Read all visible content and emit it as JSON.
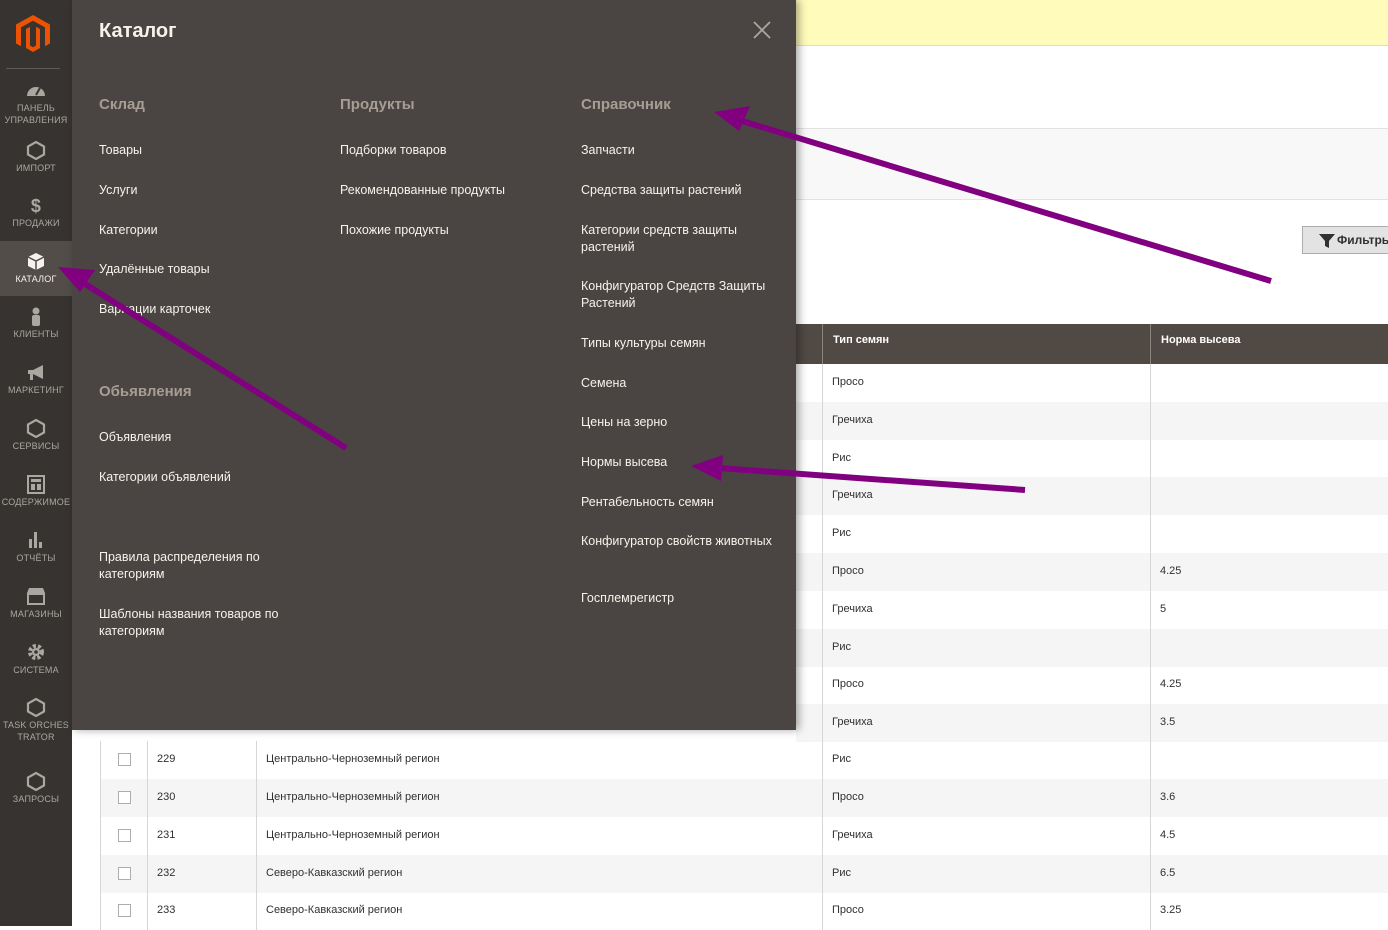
{
  "sidebar": {
    "items": [
      {
        "label": "ПАНЕЛЬ УПРАВЛЕНИЯ",
        "icon": "dashboard-icon"
      },
      {
        "label": "ИМПОРТ",
        "icon": "hexagon-icon"
      },
      {
        "label": "ПРОДАЖИ",
        "icon": "dollar-icon"
      },
      {
        "label": "КАТАЛОГ",
        "icon": "box-icon"
      },
      {
        "label": "КЛИЕНТЫ",
        "icon": "person-icon"
      },
      {
        "label": "МАРКЕТИНГ",
        "icon": "megaphone-icon"
      },
      {
        "label": "СЕРВИСЫ",
        "icon": "hexagon-icon"
      },
      {
        "label": "СОДЕРЖИМОЕ",
        "icon": "layout-icon"
      },
      {
        "label": "ОТЧЁТЫ",
        "icon": "bar-chart-icon"
      },
      {
        "label": "МАГАЗИНЫ",
        "icon": "store-icon"
      },
      {
        "label": "СИСТЕМА",
        "icon": "gear-icon"
      },
      {
        "label": "TASK ORCHESTRATOR",
        "icon": "hexagon-icon"
      },
      {
        "label": "ЗАПРОСЫ",
        "icon": "hexagon-icon"
      }
    ]
  },
  "flyout": {
    "title": "Каталог",
    "sklad": {
      "title": "Склад",
      "links": [
        "Товары",
        "Услуги",
        "Категории",
        "Удалённые товары",
        "Вариации карточек"
      ]
    },
    "obyavleniya": {
      "title": "Обьявления",
      "links": [
        "Объявления",
        "Категории объявлений"
      ]
    },
    "extra_links": [
      "Правила распределения по категориям",
      "Шаблоны названия товаров по категориям"
    ],
    "produkty": {
      "title": "Продукты",
      "links": [
        "Подборки товаров",
        "Рекомендованные продукты",
        "Похожие продукты"
      ]
    },
    "spravochnik": {
      "title": "Справочник",
      "links": [
        "Запчасти",
        "Средства защиты растений",
        "Категории средств защиты растений",
        "Конфигуратор Средств Защиты Растений",
        "Типы культуры семян",
        "Семена",
        "Цены на зерно",
        "Нормы высева",
        "Рентабельность семян",
        "Конфигуратор свойств животных",
        "Госплемрегистр"
      ]
    }
  },
  "page": {
    "filters_label": "Фильтры",
    "columns": {
      "seed_type": "Тип семян",
      "seeding_rate": "Норма высева"
    },
    "rows_partial": [
      {
        "type": "Просо",
        "rate": ""
      },
      {
        "type": "Гречиха",
        "rate": ""
      },
      {
        "type": "Рис",
        "rate": ""
      },
      {
        "type": "Гречиха",
        "rate": ""
      },
      {
        "type": "Рис",
        "rate": ""
      },
      {
        "type": "Просо",
        "rate": "4.25"
      },
      {
        "type": "Гречиха",
        "rate": "5"
      },
      {
        "type": "Рис",
        "rate": ""
      },
      {
        "type": "Просо",
        "rate": "4.25"
      },
      {
        "type": "Гречиха",
        "rate": "3.5"
      }
    ],
    "rows_full": [
      {
        "id": "229",
        "region": "Центрально-Черноземный регион",
        "type": "Рис",
        "rate": ""
      },
      {
        "id": "230",
        "region": "Центрально-Черноземный регион",
        "type": "Просо",
        "rate": "3.6"
      },
      {
        "id": "231",
        "region": "Центрально-Черноземный регион",
        "type": "Гречиха",
        "rate": "4.5"
      },
      {
        "id": "232",
        "region": "Северо-Кавказский регион",
        "type": "Рис",
        "rate": "6.5"
      },
      {
        "id": "233",
        "region": "Северо-Кавказский регион",
        "type": "Просо",
        "rate": "3.25"
      }
    ]
  },
  "colors": {
    "sidebar_bg": "#373330",
    "flyout_bg": "#4a4542",
    "grid_header_bg": "#514943",
    "annotation_arrow": "#800080",
    "brand_orange": "#eb5202"
  }
}
